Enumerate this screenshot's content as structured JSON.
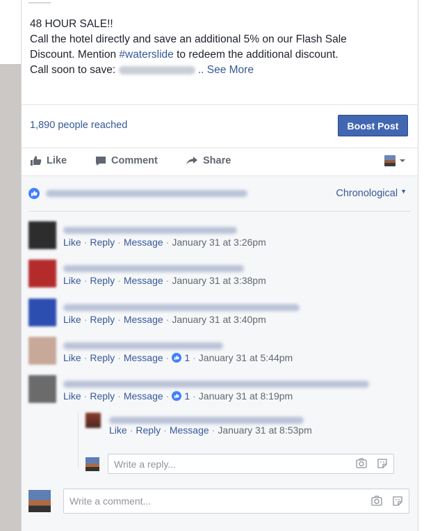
{
  "post": {
    "title": "48 HOUR SALE!!",
    "line1": "Call the hotel directly and save an additional 5% on our Flash Sale",
    "line2_pre": "Discount. Mention ",
    "hashtag": "#waterslide",
    "line2_post": " to redeem the additional discount.",
    "line3_pre": "Call soon to save: ",
    "see_more": ".. See More"
  },
  "stats": {
    "reach": "1,890 people reached",
    "boost_label": "Boost Post"
  },
  "actions": {
    "like": "Like",
    "comment": "Comment",
    "share": "Share"
  },
  "comments_header": {
    "sort": "Chronological"
  },
  "comments": [
    {
      "like": "Like",
      "reply": "Reply",
      "message": "Message",
      "time": "January 31 at 3:26pm",
      "avatar_color": "#2d2d2d"
    },
    {
      "like": "Like",
      "reply": "Reply",
      "message": "Message",
      "time": "January 31 at 3:38pm",
      "avatar_color": "#b32b2b"
    },
    {
      "like": "Like",
      "reply": "Reply",
      "message": "Message",
      "time": "January 31 at 3:40pm",
      "avatar_color": "#2b4eb0"
    },
    {
      "like": "Like",
      "reply": "Reply",
      "message": "Message",
      "likes": "1",
      "time": "January 31 at 5:44pm",
      "avatar_color": "#c8a898"
    },
    {
      "like": "Like",
      "reply": "Reply",
      "message": "Message",
      "likes": "1",
      "time": "January 31 at 8:19pm",
      "avatar_color": "#6b6b6b"
    }
  ],
  "reply": {
    "like": "Like",
    "reply": "Reply",
    "message": "Message",
    "time": "January 31 at 8:53pm"
  },
  "reply_input": {
    "placeholder": "Write a reply..."
  },
  "comment_input": {
    "placeholder": "Write a comment..."
  },
  "colors": {
    "link": "#365899",
    "boost_bg": "#4267b2",
    "comments_bg": "#f6f7f9"
  }
}
